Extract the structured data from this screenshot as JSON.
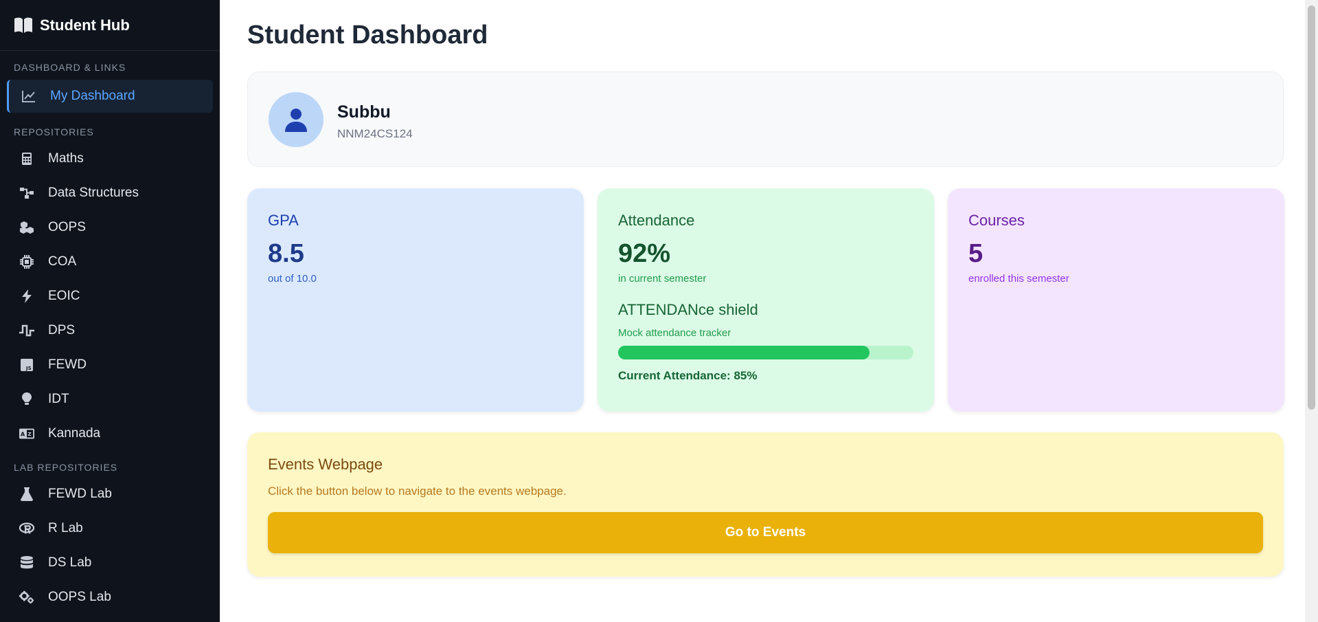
{
  "sidebar": {
    "brand": "Student Hub",
    "sections": {
      "dashboard": "DASHBOARD & LINKS",
      "repos": "REPOSITORIES",
      "labs": "LAB REPOSITORIES"
    },
    "dashboard_item": {
      "label": "My Dashboard",
      "icon": "chart-line-icon"
    },
    "repo_items": [
      {
        "label": "Maths",
        "icon": "calculator-icon"
      },
      {
        "label": "Data Structures",
        "icon": "sitemap-icon"
      },
      {
        "label": "OOPS",
        "icon": "cubes-icon"
      },
      {
        "label": "COA",
        "icon": "microchip-icon"
      },
      {
        "label": "EOIC",
        "icon": "bolt-icon"
      },
      {
        "label": "DPS",
        "icon": "wave-square-icon"
      },
      {
        "label": "FEWD",
        "icon": "js-file-icon"
      },
      {
        "label": "IDT",
        "icon": "lightbulb-icon"
      },
      {
        "label": "Kannada",
        "icon": "language-icon"
      }
    ],
    "lab_items": [
      {
        "label": "FEWD Lab",
        "icon": "flask-icon"
      },
      {
        "label": "R Lab",
        "icon": "r-project-icon"
      },
      {
        "label": "DS Lab",
        "icon": "database-icon"
      },
      {
        "label": "OOPS Lab",
        "icon": "gears-icon"
      }
    ]
  },
  "page": {
    "title": "Student Dashboard"
  },
  "profile": {
    "name": "Subbu",
    "id": "NNM24CS124",
    "icon": "user-icon"
  },
  "gpa": {
    "title": "GPA",
    "value": "8.5",
    "sub": "out of 10.0"
  },
  "attendance": {
    "title": "Attendance",
    "value": "92%",
    "sub": "in current semester",
    "shield_title": "ATTENDANce shield",
    "mock": "Mock attendance tracker",
    "progress": 0.85,
    "current": "Current Attendance: 85%"
  },
  "courses": {
    "title": "Courses",
    "value": "5",
    "sub": "enrolled this semester"
  },
  "events": {
    "title": "Events Webpage",
    "desc": "Click the button below to navigate to the events webpage.",
    "button": "Go to Events"
  },
  "colors": {
    "sidebar_bg": "#0f141c",
    "active_text": "#5aa7ff",
    "gpa_bg": "#dce9fd",
    "attendance_bg": "#dcfbe7",
    "courses_bg": "#f3e5fe",
    "events_bg": "#fef7c4",
    "events_button": "#e9b10a",
    "progress_fill": "#22c55e"
  }
}
